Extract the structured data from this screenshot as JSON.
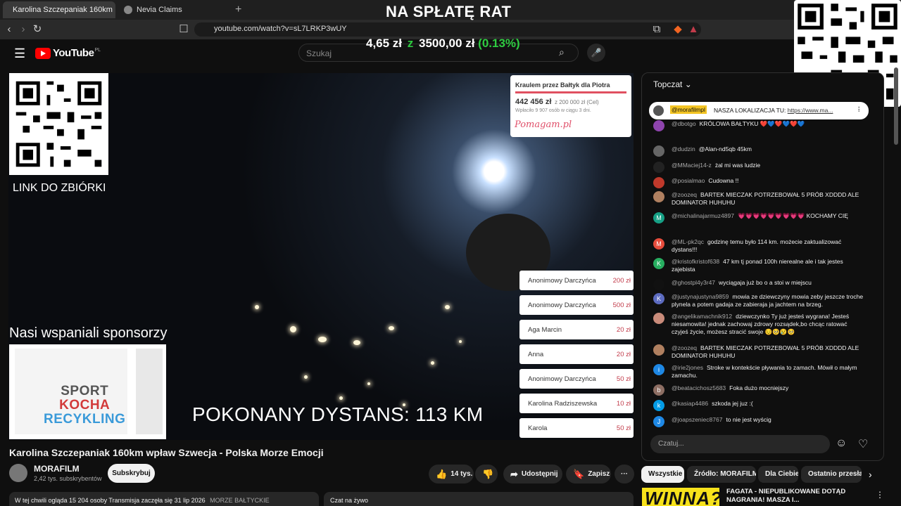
{
  "browser": {
    "tabs": [
      {
        "label": "Karolina Szczepaniak 160km",
        "active": true
      },
      {
        "label": "Nevia Claims",
        "active": false
      }
    ],
    "url": "youtube.com/watch?v=sL7LRKP3wUY"
  },
  "overlay": {
    "top_title": "NA SPŁATĘ RAT",
    "progress": {
      "current": "4,65 zł",
      "sep": "z",
      "goal": "3500,00 zł",
      "percent": "(0.13%)"
    },
    "link_label": "LINK DO ZBIÓRKI",
    "sponsors_label": "Nasi wspaniali sponsorzy",
    "sponsor_logo": {
      "line1": "SPORT",
      "line2": "KOCHA",
      "line3": "RECYKLING"
    },
    "distance": "POKONANY DYSTANS: 113 KM"
  },
  "youtube": {
    "logo": "YouTube",
    "region": "PL",
    "search_placeholder": "Szukaj"
  },
  "fundraiser": {
    "title": "Kraulem przez Bałtyk dla Piotra",
    "amount": "442 456 zł",
    "goal": "z 200 000 zł (Cel)",
    "sub": "Wpłaciło 9 907 osób w ciągu 3 dni.",
    "logo": "Pomagam.pl"
  },
  "donations": [
    {
      "name": "Anonimowy Darczyńca",
      "amount": "200 zł"
    },
    {
      "name": "Anonimowy Darczyńca",
      "amount": "500 zł"
    },
    {
      "name": "Aga Marcin",
      "amount": "20 zł"
    },
    {
      "name": "Anna",
      "amount": "20 zł"
    },
    {
      "name": "Anonimowy Darczyńca",
      "amount": "50 zł"
    },
    {
      "name": "Karolina Radziszewska",
      "amount": "10 zł"
    },
    {
      "name": "Karola",
      "amount": "50 zł"
    }
  ],
  "video": {
    "title": "Karolina Szczepaniak 160km wpław Szwecja - Polska Morze Emocji",
    "channel": "MORAFILM",
    "subs": "2,42 tys. subskrybentów",
    "subscribe": "Subskrybuj",
    "likes": "14 tys.",
    "share": "Udostępnij",
    "save": "Zapisz",
    "more": "···",
    "description": "W tej chwili ogląda 15 204 osoby  Transmisja zaczęła się 31 lip 2026",
    "description_tag": "MORZE BAŁTYCKIE",
    "live_chat": "Czat na żywo"
  },
  "chat": {
    "header": "Topczat",
    "pinned": {
      "author": "@morafilmpl",
      "text": "NASZA LOKALIZACJA TU:",
      "link": "https://www.ma..."
    },
    "messages": [
      {
        "author": "@dbotgo",
        "text": "KRÓLOWA BAŁTYKU ❤️💙❤️💙❤️💙",
        "color": "#8e44ad"
      },
      {
        "author": "@dudzin",
        "text": "@Alan-nd5qb 45km",
        "color": "#666"
      },
      {
        "author": "@MMaciej14-z",
        "text": "żal mi was ludzie",
        "color": "#222"
      },
      {
        "author": "@posialmao",
        "text": "Cudowna !!",
        "color": "#c0392b"
      },
      {
        "author": "@zoozeq",
        "text": "BARTEK MIECZAK POTRZEBOWAŁ 5 PRÓB XDDDD ALE DOMINATOR HUHUHU",
        "color": "#b08060"
      },
      {
        "author": "@michalinajarmuz4897",
        "text": "💗💗💗💗💗💗💗💗💗 KOCHAMY CIĘ",
        "color": "#16a085"
      },
      {
        "author": "@ML-pk2qc",
        "text": "godzinę temu było 114 km. możecie zaktualizować dystans!!!",
        "color": "#e74c3c"
      },
      {
        "author": "@kristofkristof638",
        "text": "47 km tj ponad 100h nierealne ale i tak jestes zajebista",
        "color": "#27ae60"
      },
      {
        "author": "@ghostpl4y3r47",
        "text": "wyciągaja już bo o a stoi w miejscu",
        "color": "#111"
      },
      {
        "author": "@justynajustyna9859",
        "text": "mowia ze dziewczyny mowia zeby jeszcze troche plynela a potem gadaja ze zabieraja ja jachtem na brzeg.",
        "color": "#5c6bc0"
      },
      {
        "author": "@angelikamachnik912",
        "text": "dziewczynko Ty już jesteś wygrana! Jesteś niesamowita! jednak zachowaj zdrowy rozsądek,bo chcąc ratować czyjeś życie, możesz stracić swoje 😔🥺😢🥺",
        "color": "#c98b7a"
      },
      {
        "author": "@zoozeq",
        "text": "BARTEK MIECZAK POTRZEBOWAŁ 5 PRÓB XDDDD ALE DOMINATOR HUHUHU",
        "color": "#b08060"
      },
      {
        "author": "@irie2jones",
        "text": "Stroke w kontekście pływania to zamach. Mówił o małym zamachu.",
        "color": "#1e88e5"
      },
      {
        "author": "@beatacichosz5683",
        "text": "Foka dużo mocniejszy",
        "color": "#8d6e63"
      },
      {
        "author": "@kasiap4486",
        "text": "szkoda jej juz :(",
        "color": "#039be5"
      },
      {
        "author": "@joapszeniec8767",
        "text": "to nie jest wyścig",
        "color": "#1e88e5"
      }
    ],
    "input_placeholder": "Czatuj..."
  },
  "chips": [
    "Wszystkie",
    "Źródło: MORAFILM",
    "Dla Ciebie",
    "Ostatnio przesłane"
  ],
  "recommendation": {
    "thumb_text": "WINNA?",
    "title": "FAGATA - NIEPUBLIKOWANE DOTĄD NAGRANIA! MASZA I..."
  }
}
